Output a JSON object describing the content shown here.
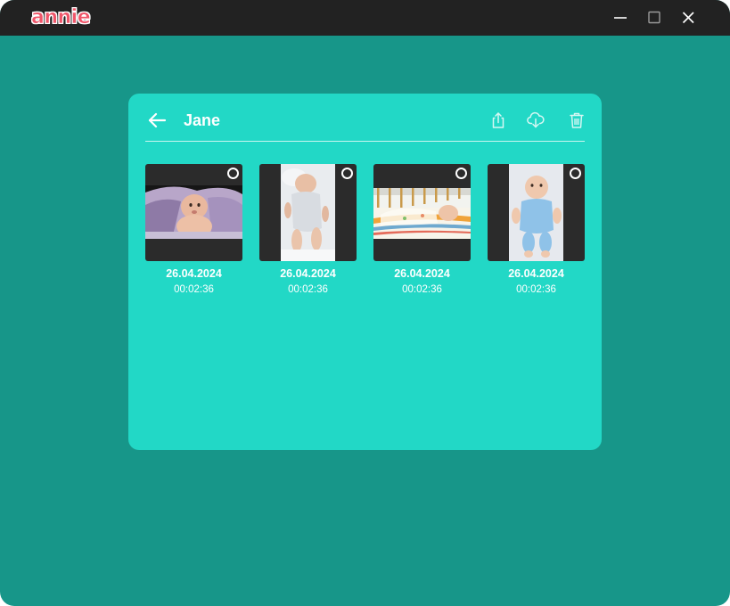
{
  "app": {
    "logo_text": "annie",
    "brand_color": "#f0566a"
  },
  "window_controls": {
    "minimize": "minimize-icon",
    "maximize": "maximize-icon",
    "close": "close-icon"
  },
  "colors": {
    "background": "#179689",
    "panel": "#22d8c6",
    "titlebar": "#222222",
    "thumb_bg": "#2b2b2b"
  },
  "panel": {
    "title": "Jane",
    "back_icon": "arrow-left-icon",
    "actions": [
      "share-icon",
      "cloud-download-icon",
      "trash-icon"
    ]
  },
  "videos": [
    {
      "date": "26.04.2024",
      "duration": "00:02:36",
      "orientation": "landscape",
      "selected": false
    },
    {
      "date": "26.04.2024",
      "duration": "00:02:36",
      "orientation": "portrait",
      "selected": false
    },
    {
      "date": "26.04.2024",
      "duration": "00:02:36",
      "orientation": "landscape",
      "selected": false
    },
    {
      "date": "26.04.2024",
      "duration": "00:02:36",
      "orientation": "portrait",
      "selected": false
    }
  ]
}
